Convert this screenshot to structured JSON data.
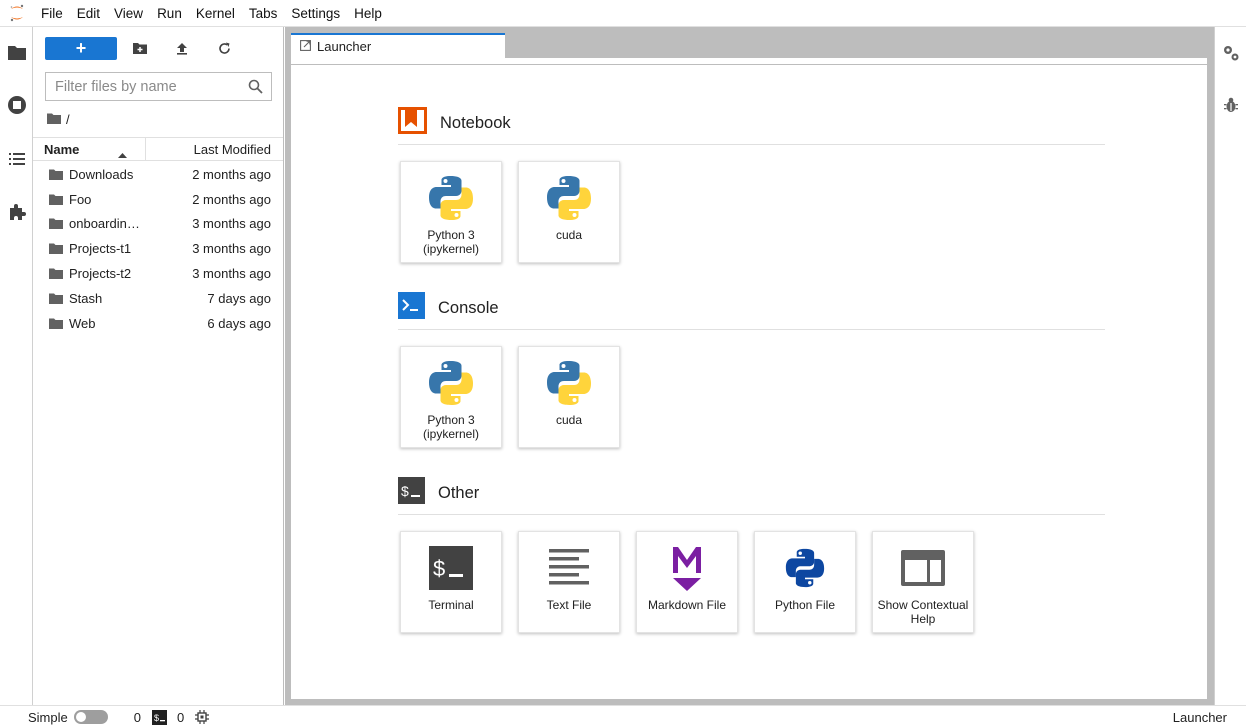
{
  "menubar": {
    "items": [
      "File",
      "Edit",
      "View",
      "Run",
      "Kernel",
      "Tabs",
      "Settings",
      "Help"
    ]
  },
  "left_sidebar": {
    "icons": [
      "folder-icon",
      "running-icon",
      "toc-icon",
      "extension-icon"
    ]
  },
  "filebrowser": {
    "new_label": "+",
    "filter_placeholder": "Filter files by name",
    "breadcrumb": "/",
    "columns": {
      "name": "Name",
      "modified": "Last Modified"
    },
    "files": [
      {
        "name": "Downloads",
        "modified": "2 months ago"
      },
      {
        "name": "Foo",
        "modified": "2 months ago"
      },
      {
        "name": "onboardin…",
        "modified": "3 months ago"
      },
      {
        "name": "Projects-t1",
        "modified": "3 months ago"
      },
      {
        "name": "Projects-t2",
        "modified": "3 months ago"
      },
      {
        "name": "Stash",
        "modified": "7 days ago"
      },
      {
        "name": "Web",
        "modified": "6 days ago"
      }
    ]
  },
  "tab": {
    "label": "Launcher"
  },
  "launcher": {
    "notebook": {
      "title": "Notebook",
      "cards": [
        {
          "line1": "Python 3",
          "line2": "(ipykernel)"
        },
        {
          "line1": "cuda",
          "line2": ""
        }
      ]
    },
    "console": {
      "title": "Console",
      "cards": [
        {
          "line1": "Python 3",
          "line2": "(ipykernel)"
        },
        {
          "line1": "cuda",
          "line2": ""
        }
      ]
    },
    "other": {
      "title": "Other",
      "cards": [
        {
          "line1": "Terminal",
          "line2": ""
        },
        {
          "line1": "Text File",
          "line2": ""
        },
        {
          "line1": "Markdown File",
          "line2": ""
        },
        {
          "line1": "Python File",
          "line2": ""
        },
        {
          "line1": "Show Contextual",
          "line2": "Help"
        }
      ]
    }
  },
  "statusbar": {
    "mode_label": "Simple",
    "kernels_count": "0",
    "terminals_count": "0",
    "current_tab": "Launcher"
  },
  "colors": {
    "accent": "#1976d2",
    "notebook_orange": "#e65100",
    "console_blue": "#1976d2",
    "markdown_purple": "#7b1fa2",
    "python_blue": "#3776ab",
    "python_yellow": "#ffd43b"
  }
}
